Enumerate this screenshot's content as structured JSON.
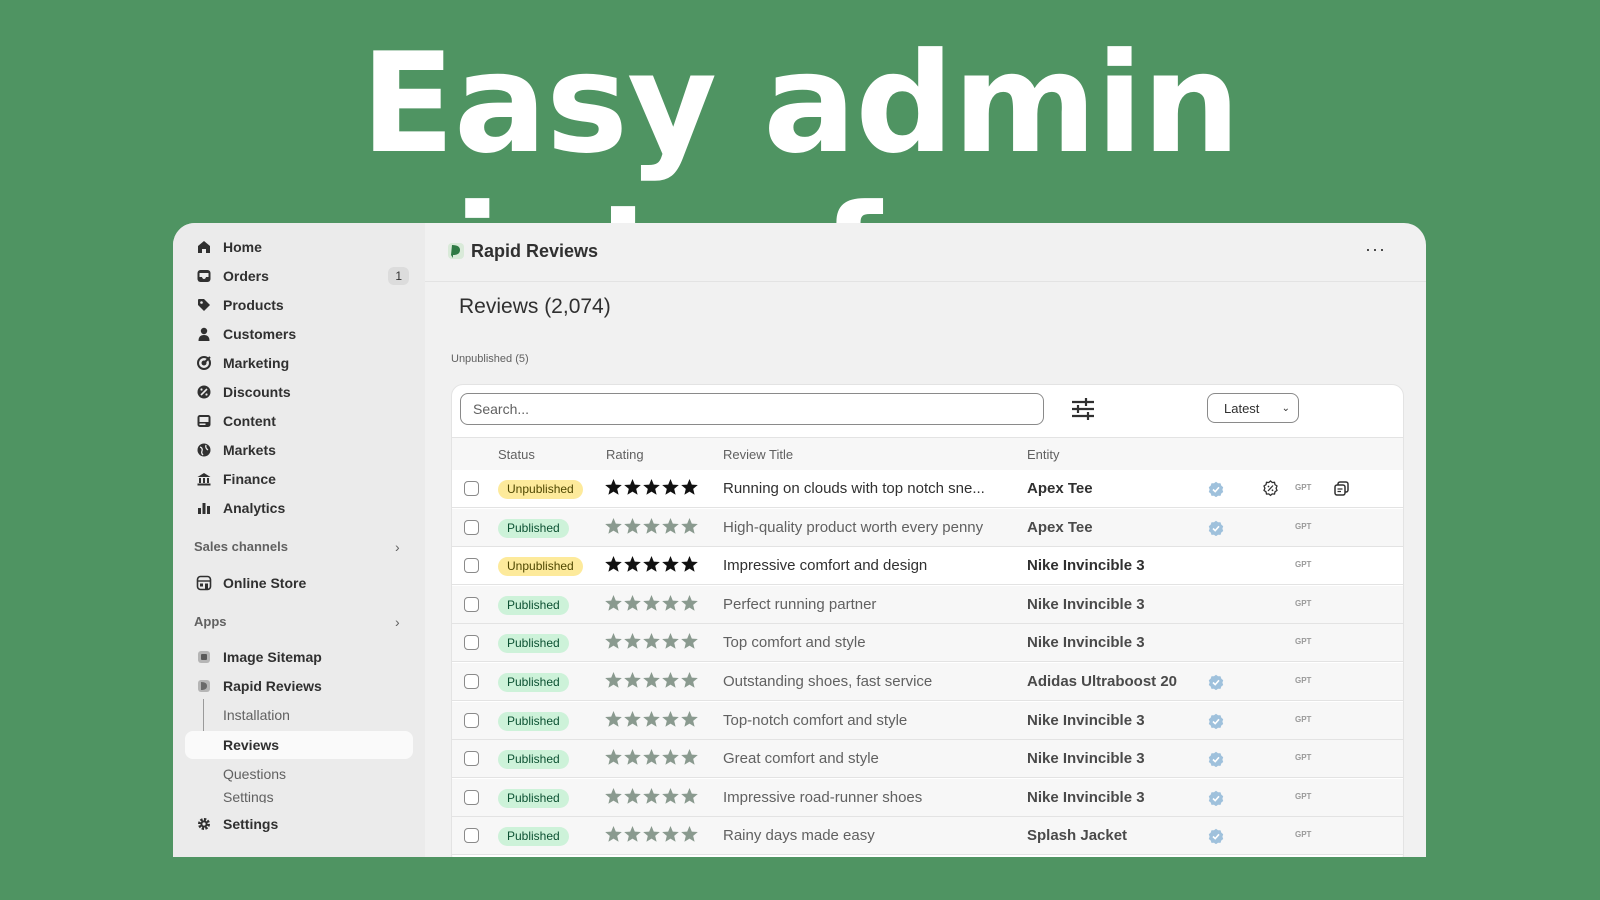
{
  "headline": "Easy admin interface",
  "colors": {
    "background": "#4f9462",
    "published_bg": "#cdf2d9",
    "unpublished_bg": "#fdea9b",
    "verified": "#9fc1dc"
  },
  "sidebar": {
    "items": [
      {
        "label": "Home",
        "icon": "home-icon"
      },
      {
        "label": "Orders",
        "icon": "inbox-icon",
        "badge": "1"
      },
      {
        "label": "Products",
        "icon": "tag-icon"
      },
      {
        "label": "Customers",
        "icon": "person-icon"
      },
      {
        "label": "Marketing",
        "icon": "target-icon"
      },
      {
        "label": "Discounts",
        "icon": "discount-icon"
      },
      {
        "label": "Content",
        "icon": "content-icon"
      },
      {
        "label": "Markets",
        "icon": "globe-icon"
      },
      {
        "label": "Finance",
        "icon": "bank-icon"
      },
      {
        "label": "Analytics",
        "icon": "bar-chart-icon"
      }
    ],
    "sales_channels_label": "Sales channels",
    "online_store": "Online Store",
    "apps_label": "Apps",
    "apps": {
      "image_sitemap": "Image Sitemap",
      "rapid_reviews": "Rapid Reviews",
      "installation": "Installation",
      "reviews": "Reviews",
      "questions": "Questions",
      "settings_sub": "Settings"
    },
    "settings": "Settings"
  },
  "header": {
    "app_title": "Rapid Reviews",
    "more": "···"
  },
  "page": {
    "title": "Reviews (2,074)",
    "unpublished_filter": "Unpublished (5)"
  },
  "toolbar": {
    "search_placeholder": "Search...",
    "sort_value": "Latest",
    "sort_chevron": "⌄"
  },
  "table": {
    "columns": {
      "status": "Status",
      "rating": "Rating",
      "review_title": "Review Title",
      "entity": "Entity"
    },
    "gpt_label": "GPT",
    "rows": [
      {
        "status": "Unpublished",
        "rating": 5,
        "title": "Running on clouds with top notch sne...",
        "entity": "Apex Tee",
        "verified": true,
        "extra_icons": true
      },
      {
        "status": "Published",
        "rating": 5,
        "title": "High-quality product worth every penny",
        "entity": "Apex Tee",
        "verified": true,
        "extra_icons": false
      },
      {
        "status": "Unpublished",
        "rating": 5,
        "title": "Impressive comfort and design",
        "entity": "Nike Invincible 3",
        "verified": false,
        "extra_icons": false
      },
      {
        "status": "Published",
        "rating": 5,
        "title": "Perfect running partner",
        "entity": "Nike Invincible 3",
        "verified": false,
        "extra_icons": false
      },
      {
        "status": "Published",
        "rating": 5,
        "title": "Top comfort and style",
        "entity": "Nike Invincible 3",
        "verified": false,
        "extra_icons": false
      },
      {
        "status": "Published",
        "rating": 5,
        "title": "Outstanding shoes, fast service",
        "entity": "Adidas Ultraboost 20",
        "verified": true,
        "extra_icons": false
      },
      {
        "status": "Published",
        "rating": 5,
        "title": "Top-notch comfort and style",
        "entity": "Nike Invincible 3",
        "verified": true,
        "extra_icons": false
      },
      {
        "status": "Published",
        "rating": 5,
        "title": "Great comfort and style",
        "entity": "Nike Invincible 3",
        "verified": true,
        "extra_icons": false
      },
      {
        "status": "Published",
        "rating": 5,
        "title": "Impressive road-runner shoes",
        "entity": "Nike Invincible 3",
        "verified": true,
        "extra_icons": false
      },
      {
        "status": "Published",
        "rating": 5,
        "title": "Rainy days made easy",
        "entity": "Splash Jacket",
        "verified": true,
        "extra_icons": false
      }
    ]
  }
}
